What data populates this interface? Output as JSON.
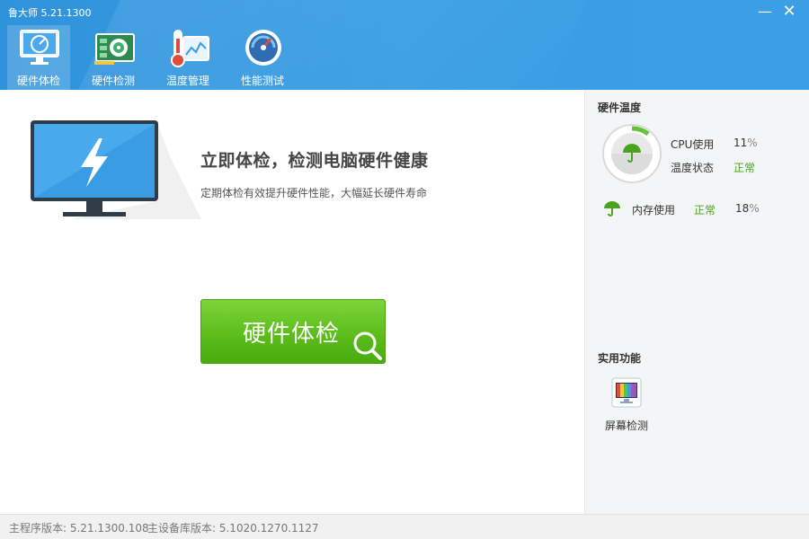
{
  "window": {
    "title": "鲁大师 5.21.1300",
    "minimize": "—",
    "close": "✕"
  },
  "tabs": [
    {
      "label": "硬件体检",
      "icon": "monitor-icon",
      "active": true
    },
    {
      "label": "硬件检测",
      "icon": "circuit-board-icon",
      "active": false
    },
    {
      "label": "温度管理",
      "icon": "thermometer-icon",
      "active": false
    },
    {
      "label": "性能测试",
      "icon": "speedometer-icon",
      "active": false
    }
  ],
  "main": {
    "headline": "立即体检，检测电脑硬件健康",
    "subline": "定期体检有效提升硬件性能，大幅延长硬件寿命",
    "check_button": "硬件体检"
  },
  "sidebar": {
    "hardware_title": "硬件温度",
    "cpu_label": "CPU使用",
    "cpu_value": "11",
    "temp_label": "温度状态",
    "temp_status": "正常",
    "mem_label": "内存使用",
    "mem_status": "正常",
    "mem_value": "18",
    "percent_sign": "%",
    "tools_title": "实用功能",
    "tools": [
      {
        "label": "屏幕检测",
        "icon": "screen-test-icon"
      }
    ]
  },
  "footer": {
    "main_version": "主程序版本: 5.21.1300.108",
    "db_version": "主设备库版本: 5.1020.1270.1127"
  },
  "colors": {
    "header_blue": "#3a9ee4",
    "button_green": "#5cbd1b",
    "status_green": "#4aa320"
  }
}
